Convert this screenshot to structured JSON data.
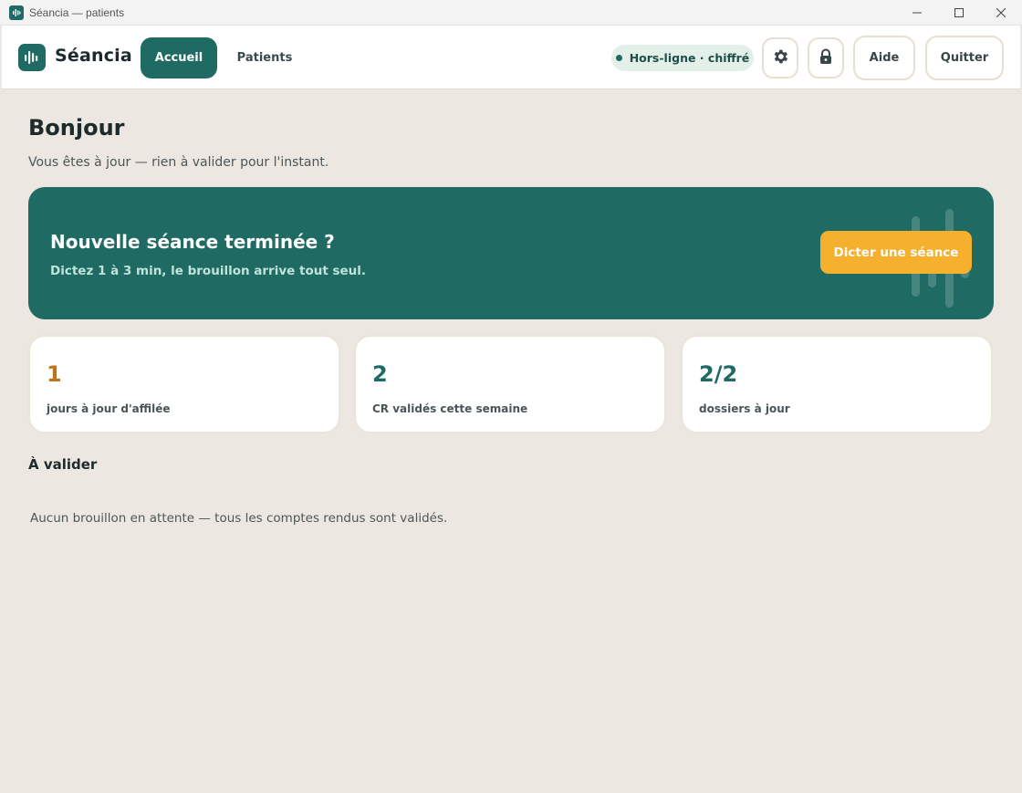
{
  "window": {
    "title": "Séancia — patients",
    "controls": {
      "minimize": "—",
      "maximize": "☐",
      "close": "✕"
    }
  },
  "header": {
    "brand": "Séancia",
    "logo_icon": "waveform-icon",
    "tabs": [
      {
        "label": "Accueil",
        "active": true
      },
      {
        "label": "Patients",
        "active": false
      }
    ],
    "status": "Hors-ligne · chiffré",
    "settings_icon": "gear-icon",
    "lock_icon": "lock-icon",
    "help_label": "Aide",
    "quit_label": "Quitter"
  },
  "main": {
    "greeting": "Bonjour",
    "subtitle": "Vous êtes à jour — rien à valider pour l'instant.",
    "hero": {
      "title": "Nouvelle séance terminée ?",
      "subtitle": "Dictez 1 à 3 min, le brouillon arrive tout seul.",
      "cta_label": "Dicter une séance"
    },
    "stats": [
      {
        "value": "1",
        "label": "jours à jour d'affilée",
        "color": "#b9781c"
      },
      {
        "value": "2",
        "label": "CR validés cette semaine",
        "color": "#1f6b63"
      },
      {
        "value": "2/2",
        "label": "dossiers à jour",
        "color": "#1f6b63"
      }
    ],
    "to_validate": {
      "title": "À valider",
      "empty_message": "Aucun brouillon en attente — tous les comptes rendus sont validés."
    }
  },
  "colors": {
    "accent": "#1f6b63",
    "cta": "#f5b02e",
    "background": "#ece7e0"
  }
}
